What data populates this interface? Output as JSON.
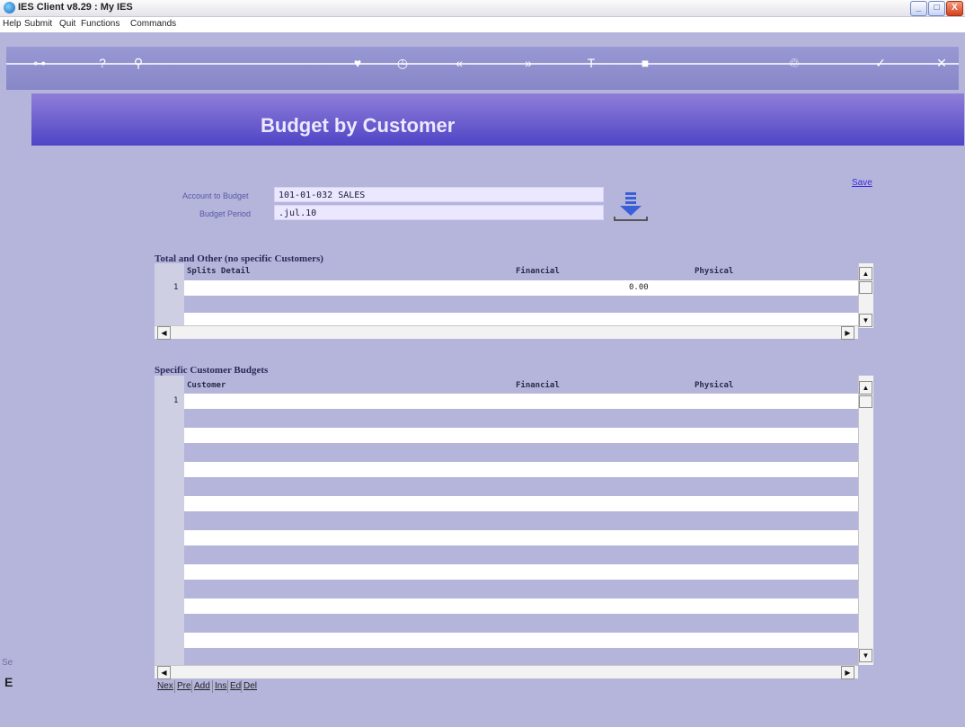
{
  "window": {
    "title": "IES Client v8.29 : My IES",
    "controls": {
      "minimize": "_",
      "maximize": "□",
      "close": "X"
    }
  },
  "menu": {
    "items": [
      "Help",
      "Submit",
      "Quit",
      "Functions",
      "Commands"
    ]
  },
  "toolbar": {
    "icons": [
      "key-icon",
      "help-icon",
      "search-icon",
      "heart-icon",
      "clock-icon",
      "rewind-icon",
      "forward-icon",
      "text-icon",
      "stop-icon",
      "recycle-icon",
      "check-icon",
      "close-icon"
    ]
  },
  "header": {
    "title": "Budget by Customer"
  },
  "actions": {
    "save": "Save"
  },
  "form": {
    "account_label": "Account to Budget",
    "account_value": "101-01-032 SALES",
    "period_label": "Budget Period",
    "period_value": ".jul.10"
  },
  "grid1": {
    "title": "Total and Other (no specific Customers)",
    "columns": [
      "Splits Detail",
      "Financial",
      "Physical"
    ],
    "rows": [
      {
        "num": "1",
        "detail": "",
        "financial": "0.00",
        "physical": ""
      }
    ]
  },
  "grid2": {
    "title": "Specific Customer Budgets",
    "columns": [
      "Customer",
      "Financial",
      "Physical"
    ],
    "rows": [
      {
        "num": "1",
        "customer": "",
        "financial": "",
        "physical": ""
      }
    ]
  },
  "nav_buttons": [
    "Nex",
    "Pre",
    "Add",
    "Ins",
    "Ed",
    "Del"
  ],
  "left_panel": {
    "label": "Se",
    "marker": "E"
  },
  "colors": {
    "background": "#b5b5dc",
    "header_gradient_start": "#8f7fd8",
    "header_gradient_end": "#4f45c6",
    "link": "#3b2ad6",
    "field_bg": "#eae7ff"
  }
}
